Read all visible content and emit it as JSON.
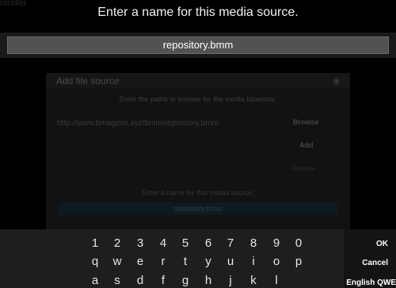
{
  "background": {
    "corner_text": "ntroller",
    "dialog": {
      "title": "Add file source",
      "subtitle": "Enter the paths or browse for the media locations.",
      "path": "http://www.bmagicrn.xyz/bmm/repository.bmm",
      "browse_label": "Browse",
      "add_label": "Add",
      "remove_label": "Remove",
      "name_label": "Enter a name for this media source.",
      "name_value": "repository.bmm"
    }
  },
  "prompt": {
    "title": "Enter a name for this media source.",
    "value": "repository.bmm"
  },
  "keyboard": {
    "row1": [
      "1",
      "2",
      "3",
      "4",
      "5",
      "6",
      "7",
      "8",
      "9",
      "0"
    ],
    "row2": [
      "q",
      "w",
      "e",
      "r",
      "t",
      "y",
      "u",
      "i",
      "o",
      "p"
    ],
    "row3": [
      "a",
      "s",
      "d",
      "f",
      "g",
      "h",
      "j",
      "k",
      "l",
      ""
    ],
    "ok_label": "OK",
    "cancel_label": "Cancel",
    "layout_label": "English QWE"
  }
}
